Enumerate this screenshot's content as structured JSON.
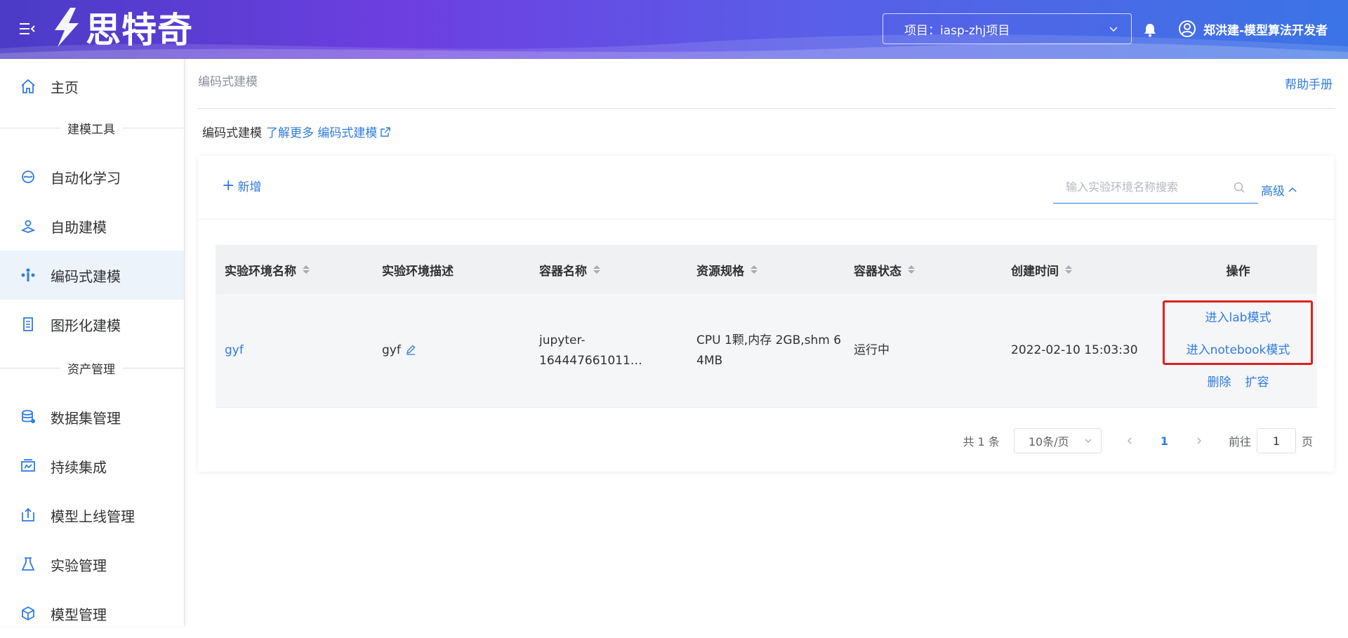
{
  "header": {
    "logo_text": "思特奇",
    "project_label": "项目：iasp-zhj项目",
    "user_name": "郑洪建-模型算法开发者"
  },
  "sidebar": {
    "items": [
      {
        "label": "主页",
        "icon": "home-icon"
      },
      {
        "group": "建模工具"
      },
      {
        "label": "自动化学习",
        "icon": "automl-icon"
      },
      {
        "label": "自助建模",
        "icon": "self-modeling-icon"
      },
      {
        "label": "编码式建模",
        "icon": "code-modeling-icon",
        "active": true
      },
      {
        "label": "图形化建模",
        "icon": "graphical-modeling-icon"
      },
      {
        "group": "资产管理"
      },
      {
        "label": "数据集管理",
        "icon": "dataset-icon"
      },
      {
        "label": "持续集成",
        "icon": "ci-icon"
      },
      {
        "label": "模型上线管理",
        "icon": "deploy-icon"
      },
      {
        "label": "实验管理",
        "icon": "experiment-icon"
      },
      {
        "label": "模型管理",
        "icon": "model-icon"
      }
    ]
  },
  "main": {
    "breadcrumb": "编码式建模",
    "help_link": "帮助手册",
    "intro_text": "编码式建模",
    "intro_link": "了解更多 编码式建模",
    "add_label": "新增",
    "search_placeholder": "输入实验环境名称搜索",
    "advanced_label": "高级",
    "table": {
      "columns": [
        "实验环境名称",
        "实验环境描述",
        "容器名称",
        "资源规格",
        "容器状态",
        "创建时间",
        "操作"
      ],
      "rows": [
        {
          "name": "gyf",
          "description": "gyf",
          "container": "jupyter-164447661011…",
          "spec_line1": "CPU 1颗,内存 2GB,shm 6",
          "spec_line2": "4MB",
          "status": "运行中",
          "created": "2022-02-10 15:03:30",
          "actions": [
            "进入lab模式",
            "进入notebook模式",
            "删除",
            "扩容"
          ]
        }
      ]
    },
    "pagination": {
      "total": "共 1 条",
      "page_size": "10条/页",
      "current_page": "1",
      "goto_label": "前往",
      "goto_value": "1",
      "page_suffix": "页"
    }
  },
  "colors": {
    "accent": "#2f7be0",
    "highlight_border": "#e02020",
    "header_gradient_start": "#4b3bc7",
    "header_gradient_end": "#3b74e6"
  }
}
